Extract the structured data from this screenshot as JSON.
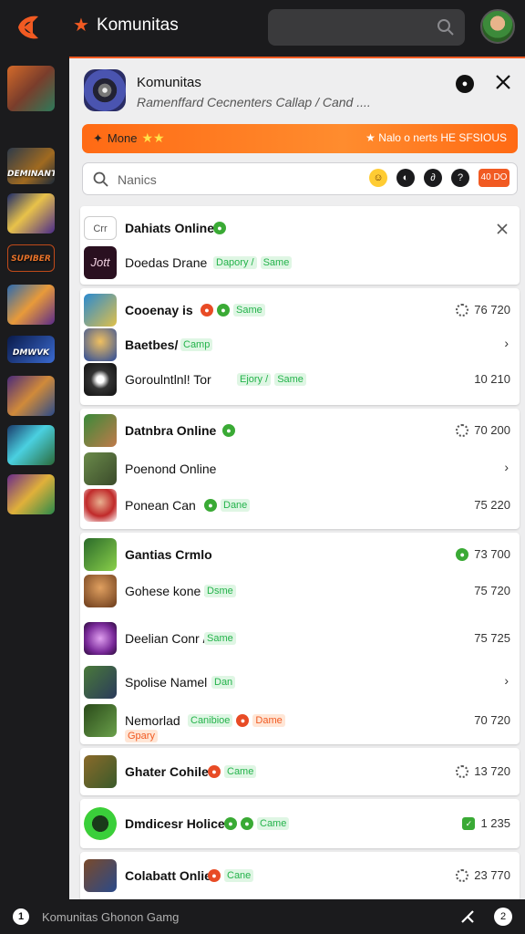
{
  "app": {
    "title": "Komunitas",
    "brand_color": "#f15a22",
    "logo_icon": "orange-arrow-logo-icon"
  },
  "sidebar": {
    "items": [
      {
        "label": ""
      },
      {
        "label": "DEMINANT"
      },
      {
        "label": ""
      },
      {
        "label": "SUPIBER"
      },
      {
        "label": ""
      },
      {
        "label": "DMWVK"
      },
      {
        "label": ""
      },
      {
        "label": ""
      },
      {
        "label": ""
      }
    ]
  },
  "panel": {
    "title": "Komunitas",
    "subtitle": "Ramenffard Cecnenters  Callap / Cand ....",
    "promo": {
      "left_label": "Mone",
      "right_label": "Nalo o nerts  HE SFSIOUS"
    },
    "search": {
      "placeholder": "Nanics",
      "badge": "40 DO"
    }
  },
  "groups": [
    {
      "rows": [
        {
          "name": "Dahiats Online",
          "bold": true,
          "tags": [
            "green-dot"
          ],
          "pill": "",
          "stat": "",
          "chev": "close"
        },
        {
          "name": "Doedas Drane",
          "bold": false,
          "pill": "Dapory /",
          "pill2": "Same",
          "stat": ""
        }
      ]
    },
    {
      "rows": [
        {
          "name": "Cooenay is",
          "bold": true,
          "pill": "Same",
          "stat": "76 720"
        },
        {
          "name": "Baetbes/",
          "bold": true,
          "pill": "Camp",
          "stat": "",
          "chev": "›"
        },
        {
          "name": "Goroulntlnl! Tor",
          "bold": false,
          "pill": "Ejory /",
          "pill2": "Same",
          "stat": "10 210"
        }
      ]
    },
    {
      "rows": [
        {
          "name": "Datnbra Online",
          "bold": true,
          "stat": "70 200"
        },
        {
          "name": "Poenond Online",
          "bold": false,
          "stat": "",
          "chev": "›"
        },
        {
          "name": "Ponean Can",
          "bold": false,
          "pill": "Dane",
          "stat": "75 220"
        }
      ]
    },
    {
      "rows": [
        {
          "name": "Gantias Crmlo",
          "bold": true,
          "stat": "73 700"
        },
        {
          "name": "Gohese kone /",
          "bold": false,
          "pill": "Dsme",
          "stat": "75 720"
        },
        {
          "name": "Deelian Conr /",
          "bold": false,
          "pill": "Same",
          "stat": "75 725"
        },
        {
          "name": "Spolise Namel",
          "bold": false,
          "pill": "Dan",
          "stat": "",
          "chev": "›"
        },
        {
          "name": "Nemorlad",
          "bold": false,
          "pill": "Canibioe",
          "pill2": "Dame",
          "pill3": "Gpary",
          "stat": "70 720"
        }
      ]
    },
    {
      "rows": [
        {
          "name": "Ghater Cohile",
          "bold": true,
          "pill": "Came",
          "stat": "13 720"
        }
      ]
    },
    {
      "rows": [
        {
          "name": "Dmdicesr Holice",
          "bold": true,
          "pill": "Came",
          "stat": "1 235"
        }
      ]
    },
    {
      "rows": [
        {
          "name": "Colabatt Onlie",
          "bold": true,
          "pill": "Cane",
          "stat": "23 770"
        }
      ]
    }
  ],
  "bottom": {
    "icon_label": "1",
    "text": "Komunitas Ghonon Gamg",
    "right_icon_label": "2"
  },
  "header_row0_left": "Crr",
  "row1_icon_text": "Jott",
  "promo_star": "✦",
  "right_star": "★"
}
